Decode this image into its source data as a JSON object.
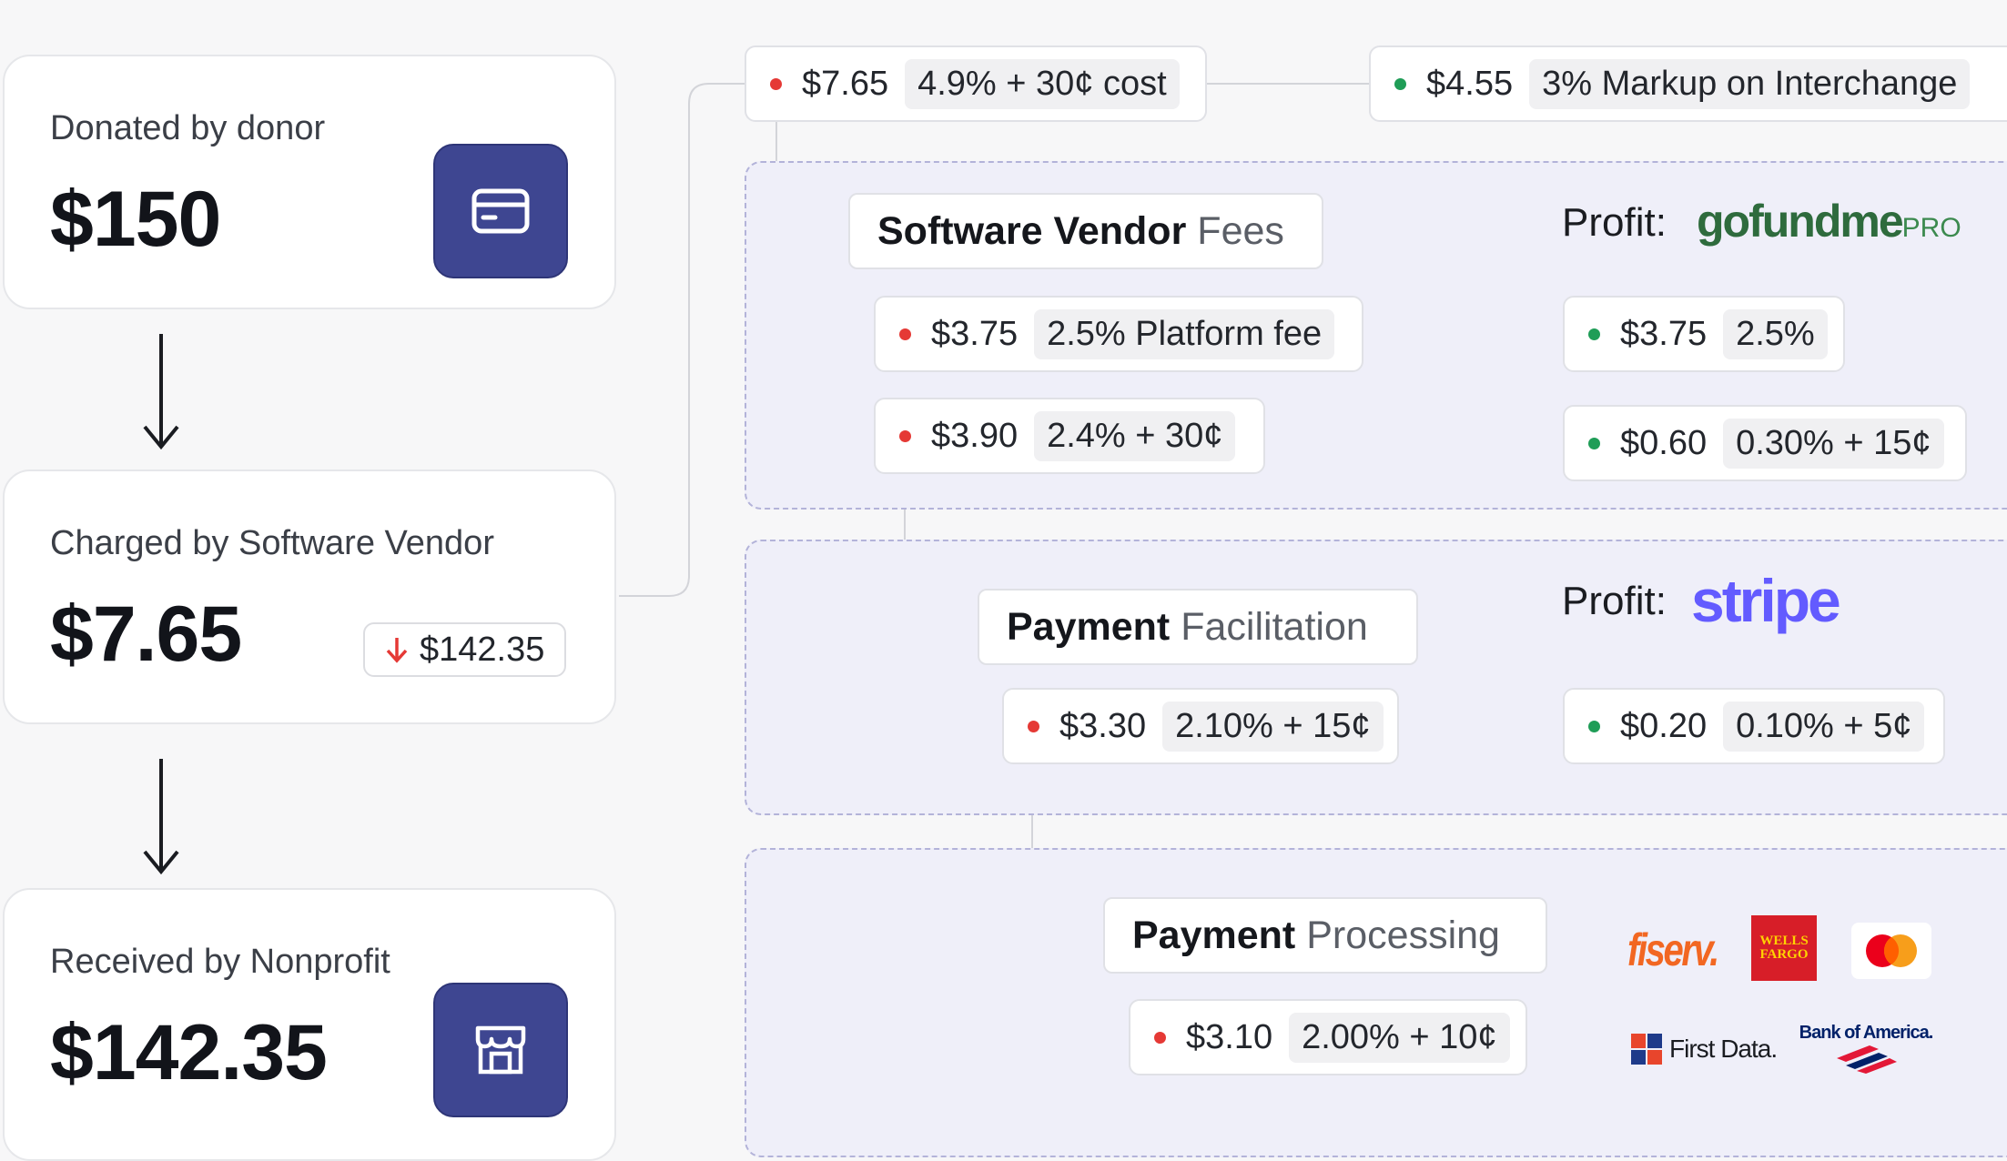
{
  "flow": {
    "donated": {
      "label": "Donated by donor",
      "amount": "$150",
      "icon": "credit-card-icon"
    },
    "charged": {
      "label": "Charged by Software Vendor",
      "amount": "$7.65",
      "remaining": "$142.35",
      "remaining_icon": "arrow-down-icon"
    },
    "received": {
      "label": "Received by Nonprofit",
      "amount": "$142.35",
      "icon": "storefront-icon"
    }
  },
  "top_row": {
    "cost": {
      "amount": "$7.65",
      "tag": "4.9% + 30¢ cost"
    },
    "markup": {
      "amount": "$4.55",
      "tag": "3% Markup on Interchange"
    }
  },
  "sections": {
    "software_vendor": {
      "title_strong": "Software Vendor",
      "title_light": "Fees",
      "profit_label": "Profit:",
      "profit_logo": {
        "part1": "gofundme",
        "part2": "PRO"
      },
      "rows": [
        {
          "cost": "$3.75",
          "cost_tag": "2.5% Platform fee",
          "profit": "$3.75",
          "profit_tag": "2.5%"
        },
        {
          "cost": "$3.90",
          "cost_tag": "2.4% + 30¢",
          "profit": "$0.60",
          "profit_tag": "0.30% + 15¢"
        }
      ]
    },
    "payment_facilitation": {
      "title_strong": "Payment",
      "title_light": "Facilitation",
      "profit_label": "Profit:",
      "profit_logo": "stripe",
      "rows": [
        {
          "cost": "$3.30",
          "cost_tag": "2.10% + 15¢",
          "profit": "$0.20",
          "profit_tag": "0.10% + 5¢"
        }
      ]
    },
    "payment_processing": {
      "title_strong": "Payment",
      "title_light": "Processing",
      "rows": [
        {
          "cost": "$3.10",
          "cost_tag": "2.00% + 10¢"
        }
      ],
      "logos": {
        "fiserv": "fiserv.",
        "wells_fargo": [
          "WELLS",
          "FARGO"
        ],
        "first_data": "First Data.",
        "bank_of_america": "Bank of America."
      }
    }
  },
  "colors": {
    "accent": "#3e4691",
    "cost_dot": "#e53935",
    "profit_dot": "#1f9d57",
    "region_fill": "#efeff9",
    "region_border": "#b3b3d9",
    "gofundme_green": "#2e6b3d",
    "stripe": "#635bff",
    "wells_fargo_red": "#d71e28",
    "mastercard_red": "#eb001b",
    "mastercard_yellow": "#f79e1b"
  }
}
